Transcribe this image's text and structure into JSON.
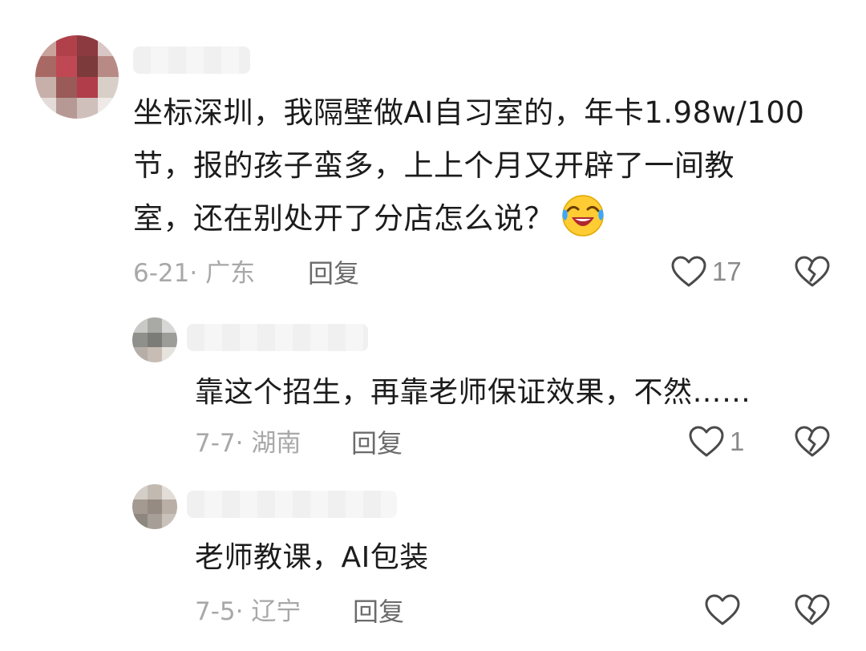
{
  "comments": [
    {
      "text_lines": [
        "坐标深圳，我隔壁做AI自习室的，年卡1.98w/100",
        "节，报的孩子蛮多，上上个月又开辟了一间教",
        "室，还在别处开了分店怎么说？"
      ],
      "emoji": "laughing-crying-emoji",
      "meta": "6-21· 广东",
      "reply_label": "回复",
      "likes": "17"
    }
  ],
  "replies": [
    {
      "text": "靠这个招生，再靠老师保证效果，不然……",
      "meta": "7-7· 湖南",
      "reply_label": "回复",
      "likes": "1"
    },
    {
      "text": "老师教课，AI包装",
      "meta": "7-5· 辽宁",
      "reply_label": "回复",
      "likes": ""
    }
  ],
  "icons": {
    "like": "heart-outline-icon",
    "dislike": "broken-heart-icon"
  },
  "colors": {
    "text": "#1c1c1c",
    "meta": "#a8a8a8",
    "reply": "#6b6b6b",
    "icon": "#4a4a4a"
  }
}
